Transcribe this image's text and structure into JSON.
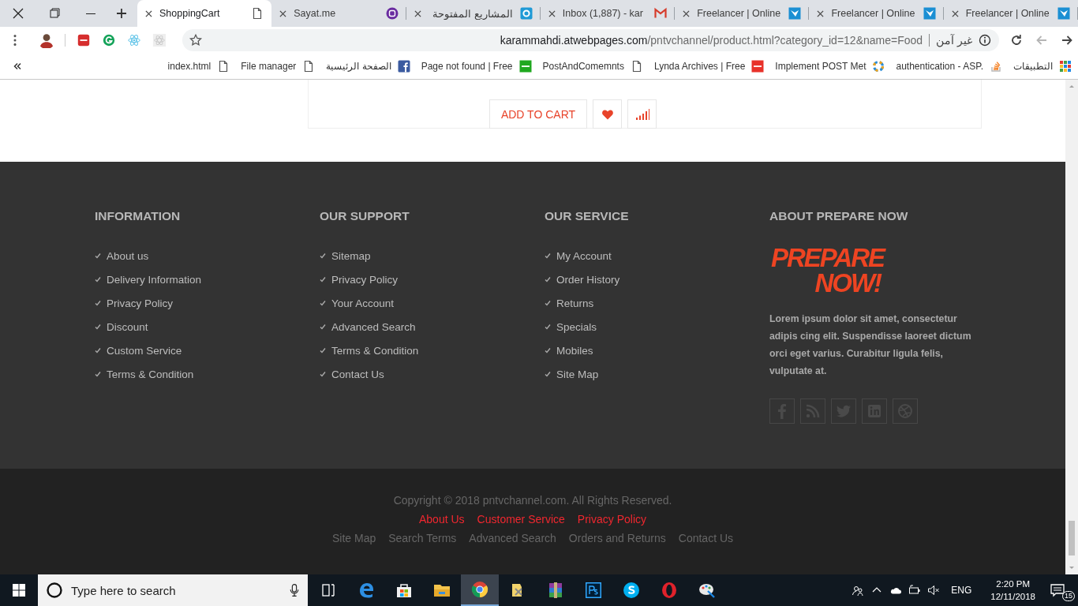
{
  "tabs": [
    {
      "title": "ShoppingCart",
      "kind": "page",
      "selected": true
    },
    {
      "title": "Sayat.me",
      "kind": "sayat",
      "selected": false
    },
    {
      "title": "المشاريع المفتوحة",
      "kind": "ring",
      "selected": false
    },
    {
      "title": "Inbox (1,887) - kar",
      "kind": "mail",
      "selected": false
    },
    {
      "title": "Freelancer | Online",
      "kind": "bird",
      "selected": false
    },
    {
      "title": "Freelancer | Online",
      "kind": "bird",
      "selected": false
    },
    {
      "title": "Freelancer | Online",
      "kind": "bird",
      "selected": false
    }
  ],
  "address_bar": {
    "url_host": "karammahdi.atwebpages.com",
    "url_path": "/pntvchannel/product.html?category_id=12&name=Food",
    "security": "غير آمن",
    "back_disabled": true
  },
  "bookmarks": [
    {
      "title": "index.html",
      "kind": "page"
    },
    {
      "title": "File manager",
      "kind": "page"
    },
    {
      "title": "الصفحة الرئيسية",
      "kind": "fb"
    },
    {
      "title": "Page not found | Free",
      "kind": "green"
    },
    {
      "title": "PostAndComemnts",
      "kind": "page"
    },
    {
      "title": "Lynda Archives | Free",
      "kind": "red"
    },
    {
      "title": "Implement POST Met",
      "kind": "wheel"
    },
    {
      "title": "authentication - ASP.",
      "kind": "stack"
    },
    {
      "title": "التطبيقات",
      "kind": "apps"
    }
  ],
  "product_actions": {
    "add_to_cart": "ADD TO CART"
  },
  "footer_columns": [
    {
      "heading": "INFORMATION",
      "links": [
        "About us",
        "Delivery Information",
        "Privacy Policy",
        "Discount",
        "Custom Service",
        "Terms & Condition"
      ]
    },
    {
      "heading": "OUR SUPPORT",
      "links": [
        "Sitemap",
        "Privacy Policy",
        "Your Account",
        "Advanced Search",
        "Terms & Condition",
        "Contact Us"
      ]
    },
    {
      "heading": "OUR SERVICE",
      "links": [
        "My Account",
        "Order History",
        "Returns",
        "Specials",
        "Mobiles",
        "Site Map"
      ]
    }
  ],
  "about": {
    "heading": "ABOUT PREPARE NOW",
    "logo": [
      "PREPARE",
      "NOW!"
    ],
    "text": "Lorem ipsum dolor sit amet, consectetur adipis cing elit. Suspendisse laoreet dictum orci eget varius. Curabitur ligula felis, vulputate at.",
    "social": [
      {
        "kind": "facebook"
      },
      {
        "kind": "rss"
      },
      {
        "kind": "twitter"
      },
      {
        "kind": "linkedin"
      },
      {
        "kind": "dribbble"
      }
    ]
  },
  "copyright": "Copyright © 2018 pntvchannel.com. All Rights Reserved.",
  "primary_links": [
    "About Us",
    "Customer Service",
    "Privacy Policy"
  ],
  "secondary_links": [
    "Site Map",
    "Search Terms",
    "Advanced Search",
    "Orders and Returns",
    "Contact Us"
  ],
  "taskbar": {
    "search_placeholder": "Type here to search",
    "apps": [
      {
        "kind": "edge",
        "active": false
      },
      {
        "kind": "store",
        "active": false
      },
      {
        "kind": "folder",
        "active": false
      },
      {
        "kind": "chrome",
        "active": true
      },
      {
        "kind": "tool",
        "active": false
      },
      {
        "kind": "archive",
        "active": false
      },
      {
        "kind": "ps",
        "active": false
      },
      {
        "kind": "skype",
        "active": false
      },
      {
        "kind": "opera",
        "active": false
      },
      {
        "kind": "paint",
        "active": false
      }
    ],
    "language": "ENG",
    "time": "2:20 PM",
    "date": "12/11/2018",
    "notifications": "15"
  }
}
